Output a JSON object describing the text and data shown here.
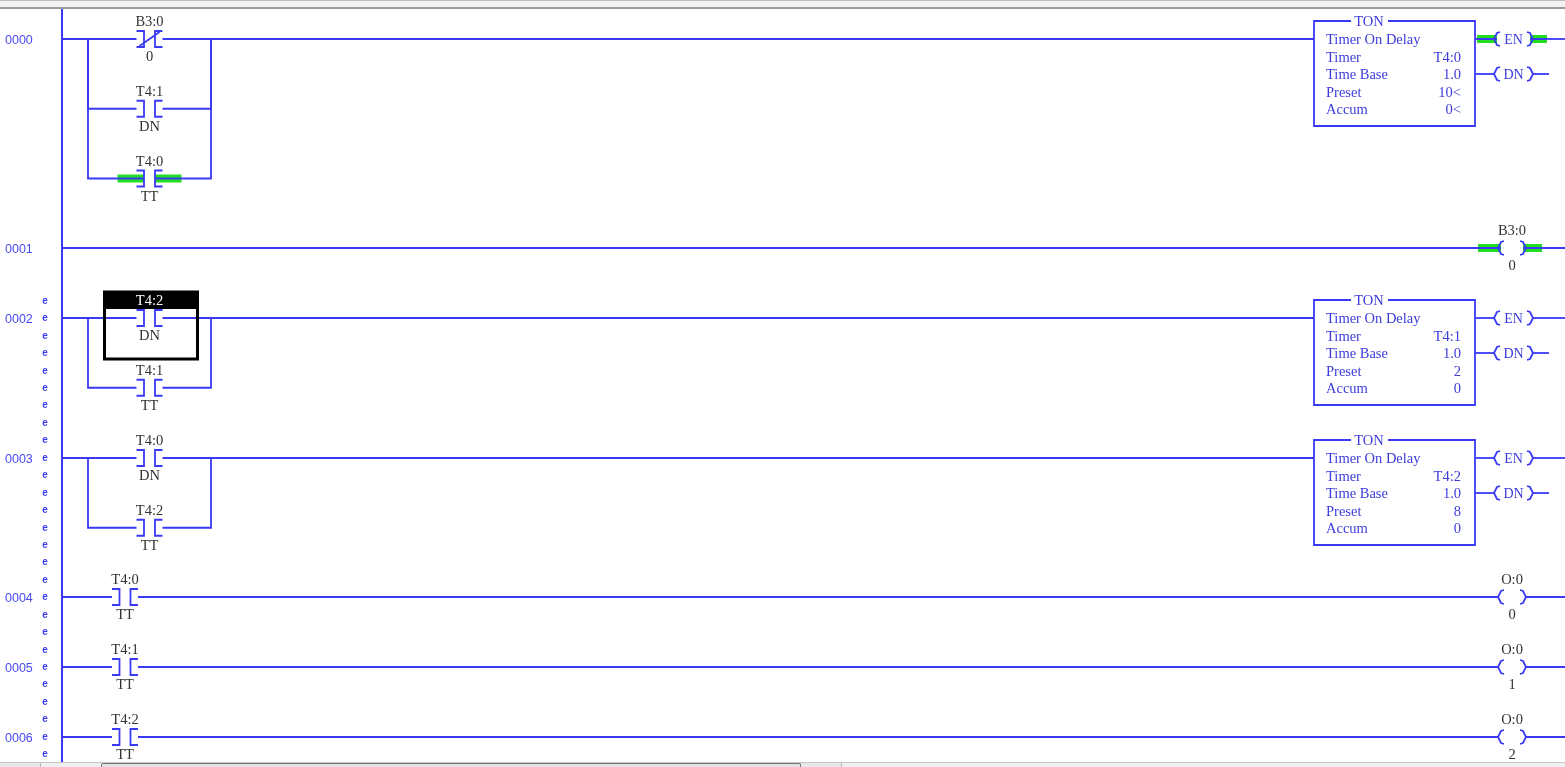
{
  "rungs": [
    {
      "number": "0000",
      "branches": [
        {
          "instructions": [
            {
              "kind": "xio",
              "address": "B3:0",
              "bit": "0",
              "energized": false,
              "selected": false
            }
          ]
        },
        {
          "instructions": [
            {
              "kind": "xic",
              "address": "T4:1",
              "bit": "DN",
              "energized": false,
              "selected": false
            }
          ]
        },
        {
          "instructions": [
            {
              "kind": "xic",
              "address": "T4:0",
              "bit": "TT",
              "energized": true,
              "selected": false
            }
          ]
        }
      ],
      "outputs": [
        {
          "kind": "ton",
          "title": "TON",
          "description": "Timer On Delay",
          "rows": [
            {
              "label": "Timer",
              "value": "T4:0"
            },
            {
              "label": "Time Base",
              "value": "1.0"
            },
            {
              "label": "Preset",
              "value": "10<"
            },
            {
              "label": "Accum",
              "value": "0<"
            }
          ],
          "coils": [
            {
              "label": "EN",
              "energized": true
            },
            {
              "label": "DN",
              "energized": false
            }
          ],
          "selected": false
        }
      ]
    },
    {
      "number": "0001",
      "outputs": [
        {
          "kind": "ote",
          "address": "B3:0",
          "bit": "0",
          "energized": true,
          "selected": false
        }
      ]
    },
    {
      "number": "0002",
      "edit_marks": [
        "e",
        "e",
        "e",
        "e",
        "e",
        "e",
        "e",
        "e"
      ],
      "branches": [
        {
          "instructions": [
            {
              "kind": "xic",
              "address": "T4:2",
              "bit": "DN",
              "energized": false,
              "selected": true
            }
          ]
        },
        {
          "instructions": [
            {
              "kind": "xic",
              "address": "T4:1",
              "bit": "TT",
              "energized": false,
              "selected": false
            }
          ]
        }
      ],
      "outputs": [
        {
          "kind": "ton",
          "title": "TON",
          "description": "Timer On Delay",
          "rows": [
            {
              "label": "Timer",
              "value": "T4:1"
            },
            {
              "label": "Time Base",
              "value": "1.0"
            },
            {
              "label": "Preset",
              "value": "2"
            },
            {
              "label": "Accum",
              "value": "0"
            }
          ],
          "coils": [
            {
              "label": "EN",
              "energized": false
            },
            {
              "label": "DN",
              "energized": false
            }
          ],
          "selected": false
        }
      ]
    },
    {
      "number": "0003",
      "edit_marks": [
        "e",
        "e",
        "e",
        "e",
        "e",
        "e",
        "e",
        "e"
      ],
      "branches": [
        {
          "instructions": [
            {
              "kind": "xic",
              "address": "T4:0",
              "bit": "DN",
              "energized": false,
              "selected": false
            }
          ]
        },
        {
          "instructions": [
            {
              "kind": "xic",
              "address": "T4:2",
              "bit": "TT",
              "energized": false,
              "selected": false
            }
          ]
        }
      ],
      "outputs": [
        {
          "kind": "ton",
          "title": "TON",
          "description": "Timer On Delay",
          "rows": [
            {
              "label": "Timer",
              "value": "T4:2"
            },
            {
              "label": "Time Base",
              "value": "1.0"
            },
            {
              "label": "Preset",
              "value": "8"
            },
            {
              "label": "Accum",
              "value": "0"
            }
          ],
          "coils": [
            {
              "label": "EN",
              "energized": false
            },
            {
              "label": "DN",
              "energized": false
            }
          ],
          "selected": false
        }
      ]
    },
    {
      "number": "0004",
      "edit_marks": [
        "e",
        "e",
        "e",
        "e"
      ],
      "branches": [
        {
          "instructions": [
            {
              "kind": "xic",
              "address": "T4:0",
              "bit": "TT",
              "energized": false,
              "selected": false
            }
          ]
        }
      ],
      "outputs": [
        {
          "kind": "ote",
          "address": "O:0",
          "bit": "0",
          "energized": false,
          "selected": false
        }
      ]
    },
    {
      "number": "0005",
      "edit_marks": [
        "e",
        "e",
        "e",
        "e"
      ],
      "branches": [
        {
          "instructions": [
            {
              "kind": "xic",
              "address": "T4:1",
              "bit": "TT",
              "energized": false,
              "selected": false
            }
          ]
        }
      ],
      "outputs": [
        {
          "kind": "ote",
          "address": "O:0",
          "bit": "1",
          "energized": false,
          "selected": false
        }
      ]
    },
    {
      "number": "0006",
      "edit_marks": [
        "e",
        "e",
        "e"
      ],
      "branches": [
        {
          "instructions": [
            {
              "kind": "xic",
              "address": "T4:2",
              "bit": "TT",
              "energized": false,
              "selected": false
            }
          ]
        }
      ],
      "outputs": [
        {
          "kind": "ote",
          "address": "O:0",
          "bit": "2",
          "energized": false,
          "selected": false
        }
      ]
    }
  ]
}
